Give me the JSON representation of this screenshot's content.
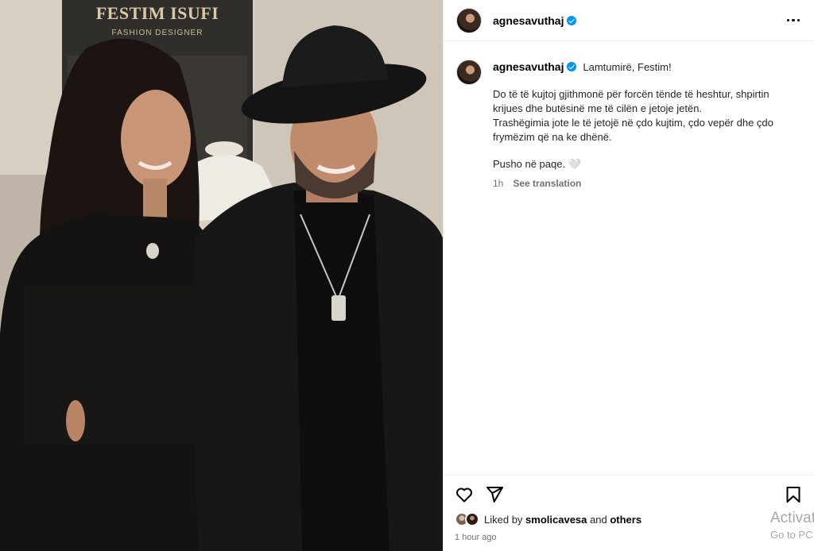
{
  "post": {
    "username": "agnesavuthaj",
    "verified": true,
    "caption_title": "Lamtumirë, Festim!",
    "caption_lines": [
      "Do të të kujtoj gjithmonë për forcën tënde të heshtur, shpirtin",
      "krijues dhe butësinë me të cilën e jetoje jetën.",
      "Trashëgimia jote le të jetojë në çdo kujtim, çdo vepër dhe çdo",
      "frymëzim që na ke dhënë."
    ],
    "caption_closing": "Pusho në paqe. 🤍",
    "caption_time": "1h",
    "see_translation": "See translation",
    "liked_by_prefix": "Liked by",
    "liked_by_user": "smolicavesa",
    "liked_by_and": "and",
    "liked_by_others": "others",
    "post_time": "1 hour ago"
  },
  "photo": {
    "banner_title": "FESTIM ISUFI",
    "banner_subtitle": "FASHION DESIGNER"
  },
  "watermark": {
    "line1": "Activate Windows",
    "line2": "Go to PC settings"
  },
  "icons": {
    "more": "more-options-icon",
    "like": "heart-icon",
    "share": "paper-plane-icon",
    "save": "bookmark-icon"
  }
}
